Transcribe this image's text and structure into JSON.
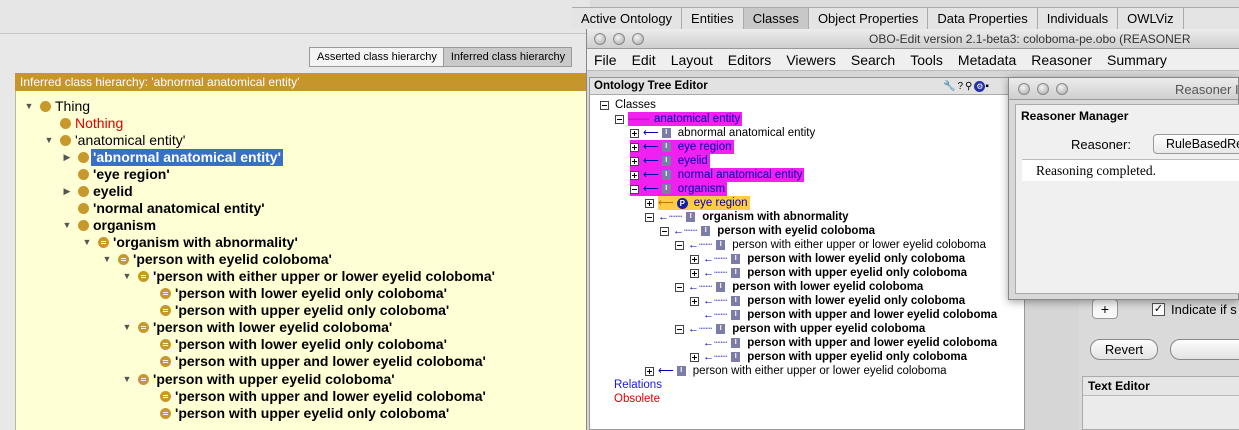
{
  "protege": {
    "toggle": {
      "asserted": "Asserted class hierarchy",
      "inferred": "Inferred class hierarchy"
    },
    "panel_title": "Inferred class hierarchy: 'abnormal anatomical entity'",
    "tree": [
      {
        "label": "Thing",
        "icon": "class-icon"
      },
      {
        "label": "Nothing",
        "icon": "class-icon"
      },
      {
        "label": "'anatomical entity'",
        "icon": "class-icon"
      },
      {
        "label": "'abnormal anatomical entity'",
        "icon": "class-icon"
      },
      {
        "label": "'eye region'",
        "icon": "class-icon"
      },
      {
        "label": "eyelid",
        "icon": "class-icon"
      },
      {
        "label": "'normal anatomical entity'",
        "icon": "class-icon"
      },
      {
        "label": "organism",
        "icon": "class-icon"
      },
      {
        "label": "'organism with abnormality'",
        "icon": "defined-class-icon"
      },
      {
        "label": "'person with eyelid coloboma'",
        "icon": "defined-class-icon"
      },
      {
        "label": "'person with either upper or lower eyelid coloboma'",
        "icon": "defined-class-icon"
      },
      {
        "label": "'person with lower eyelid only coloboma'",
        "icon": "defined-class-icon"
      },
      {
        "label": "'person with upper eyelid only coloboma'",
        "icon": "defined-class-icon"
      },
      {
        "label": "'person with lower eyelid coloboma'",
        "icon": "defined-class-icon"
      },
      {
        "label": "'person with lower eyelid only coloboma'",
        "icon": "defined-class-icon"
      },
      {
        "label": "'person with upper and lower eyelid coloboma'",
        "icon": "defined-class-icon"
      },
      {
        "label": "'person with upper eyelid coloboma'",
        "icon": "defined-class-icon"
      },
      {
        "label": "'person with upper and lower eyelid coloboma'",
        "icon": "defined-class-icon"
      },
      {
        "label": "'person with upper eyelid only coloboma'",
        "icon": "defined-class-icon"
      }
    ],
    "tabs": [
      "Active Ontology",
      "Entities",
      "Classes",
      "Object Properties",
      "Data Properties",
      "Individuals",
      "OWLViz"
    ],
    "selected_color": "#3a6fc6",
    "tree_bg": "#ffffd5"
  },
  "obo": {
    "window_title": "OBO-Edit version 2.1-beta3: coloboma-pe.obo (REASONER",
    "menu": [
      "File",
      "Edit",
      "Layout",
      "Editors",
      "Viewers",
      "Search",
      "Tools",
      "Metadata",
      "Reasoner",
      "Summary"
    ],
    "editor_title": "Ontology Tree Editor",
    "tree_root": "Classes",
    "tree": [
      {
        "label": "anatomical entity"
      },
      {
        "label": "abnormal anatomical entity"
      },
      {
        "label": "eye region"
      },
      {
        "label": "eyelid"
      },
      {
        "label": "normal anatomical entity"
      },
      {
        "label": "organism"
      },
      {
        "label": "eye region",
        "badge": "P"
      },
      {
        "label": "organism with abnormality"
      },
      {
        "label": "person with eyelid coloboma"
      },
      {
        "label": "person with either upper or lower eyelid coloboma"
      },
      {
        "label": "person with lower eyelid only coloboma"
      },
      {
        "label": "person with upper eyelid only coloboma"
      },
      {
        "label": "person with lower eyelid coloboma"
      },
      {
        "label": "person with lower eyelid only coloboma"
      },
      {
        "label": "person with upper and lower eyelid coloboma"
      },
      {
        "label": "person with upper eyelid coloboma"
      },
      {
        "label": "person with upper and lower eyelid coloboma"
      },
      {
        "label": "person with upper eyelid only coloboma"
      },
      {
        "label": "person with either upper or lower eyelid coloboma"
      }
    ],
    "relations": "Relations",
    "obsolete": "Obsolete",
    "indicate_label": "Indicate if s",
    "revert": "Revert",
    "text_editor": "Text Editor",
    "highlight_color": "#f020f0"
  },
  "reasoner": {
    "window_title": "Reasoner I",
    "panel_title": "Reasoner Manager",
    "reasoner_label": "Reasoner:",
    "reasoner_value": "RuleBasedReas",
    "status": "Reasoning completed."
  }
}
